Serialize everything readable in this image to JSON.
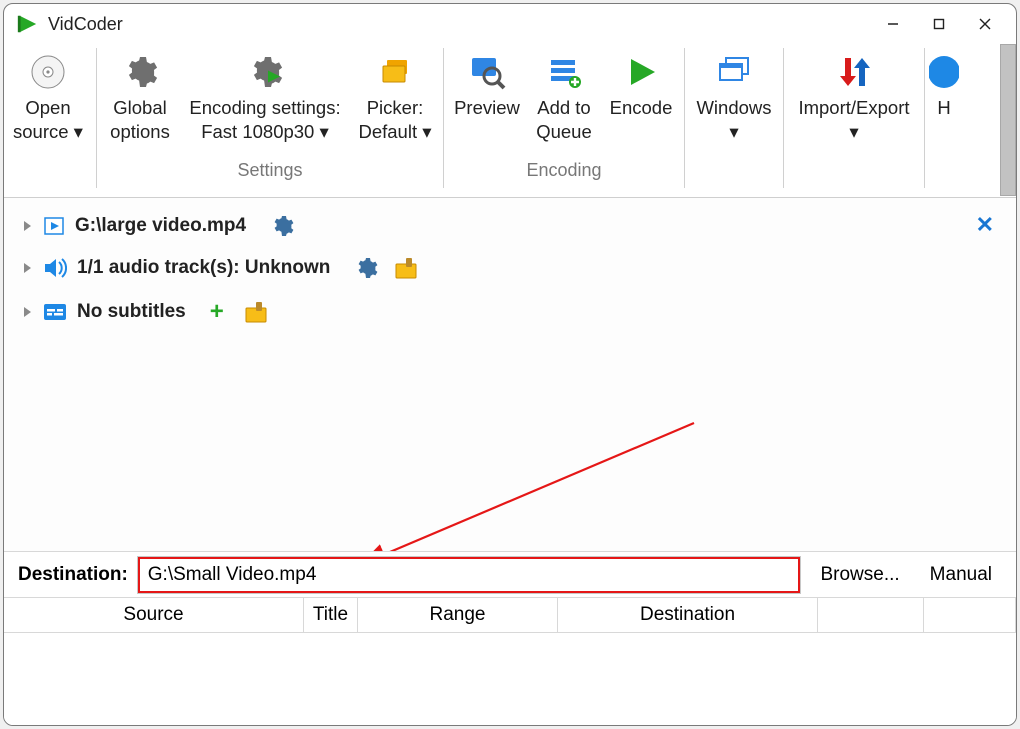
{
  "titlebar": {
    "app_name": "VidCoder"
  },
  "toolbar": {
    "open_source": "Open\nsource ▾",
    "global_options": "Global\noptions",
    "encoding_settings": "Encoding settings:\nFast 1080p30 ▾",
    "picker": "Picker:\nDefault ▾",
    "settings_group": "Settings",
    "preview": "Preview",
    "add_to_queue": "Add to\nQueue",
    "encode": "Encode",
    "encoding_group": "Encoding",
    "windows": "Windows\n▾",
    "import_export": "Import/Export\n▾",
    "help_truncated": "H"
  },
  "source": {
    "file_row": "G:\\large video.mp4",
    "audio_row": "1/1 audio track(s): Unknown",
    "subs_row": "No subtitles"
  },
  "destination": {
    "label": "Destination:",
    "value": "G:\\Small Video.mp4",
    "browse": "Browse...",
    "manual": "Manual"
  },
  "columns": {
    "source": "Source",
    "title": "Title",
    "range": "Range",
    "dest": "Destination"
  }
}
